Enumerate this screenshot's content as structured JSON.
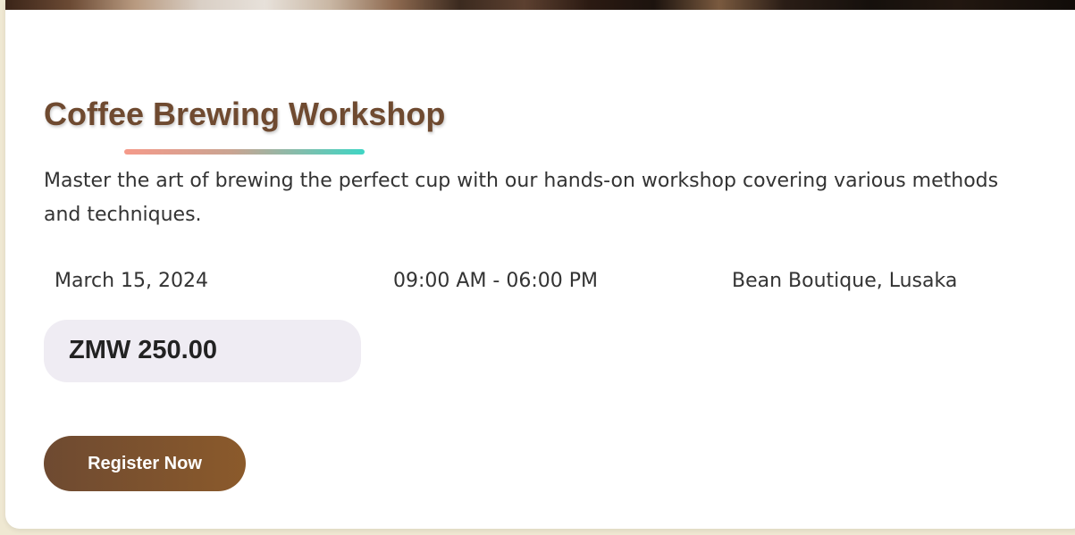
{
  "event": {
    "title": "Coffee Brewing Workshop",
    "description": "Master the art of brewing the perfect cup with our hands-on workshop covering various methods and techniques.",
    "date": "March 15, 2024",
    "time": "09:00 AM - 06:00 PM",
    "location": "Bean Boutique, Lusaka",
    "price": "ZMW 250.00",
    "register_label": "Register Now"
  },
  "colors": {
    "page_background": "#efe8d2",
    "title": "#6f4a30",
    "button_start": "#6e4a31",
    "button_end": "#8b5a2b",
    "underline_start": "#f59a8a",
    "underline_end": "#3fd5c4",
    "price_box": "#efecf3"
  }
}
